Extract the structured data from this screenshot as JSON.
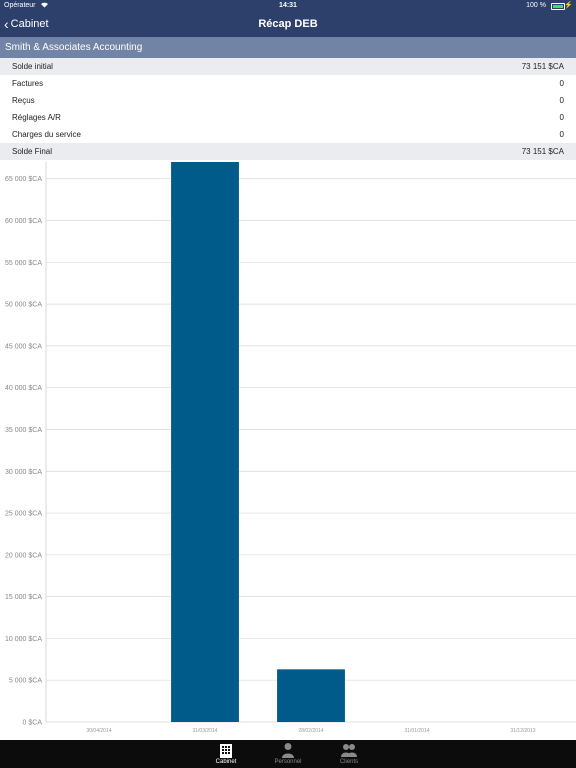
{
  "status": {
    "carrier": "Opérateur",
    "time": "14:31",
    "battery": "100 %",
    "battery_level": 1.0
  },
  "nav": {
    "back_label": "Cabinet",
    "title": "Récap DEB"
  },
  "section": {
    "title": "Smith & Associates Accounting"
  },
  "summary": [
    {
      "label": "Solde initial",
      "value": "73 151 $CA",
      "shaded": true
    },
    {
      "label": "Factures",
      "value": "0",
      "shaded": false
    },
    {
      "label": "Reçus",
      "value": "0",
      "shaded": false
    },
    {
      "label": "Réglages A/R",
      "value": "0",
      "shaded": false
    },
    {
      "label": "Charges du service",
      "value": "0",
      "shaded": false
    },
    {
      "label": "Solde Final",
      "value": "73 151 $CA",
      "shaded": true
    }
  ],
  "chart_data": {
    "type": "bar",
    "categories": [
      "30/04/2014",
      "31/03/2014",
      "28/02/2014",
      "31/01/2014",
      "31/12/2013"
    ],
    "values": [
      0,
      67000,
      6300,
      0,
      0
    ],
    "ylim": [
      0,
      67000
    ],
    "yticks": [
      0,
      5000,
      10000,
      15000,
      20000,
      25000,
      30000,
      35000,
      40000,
      45000,
      50000,
      55000,
      60000,
      65000
    ],
    "ytick_labels": [
      "0 $CA",
      "5 000 $CA",
      "10 000 $CA",
      "15 000 $CA",
      "20 000 $CA",
      "25 000 $CA",
      "30 000 $CA",
      "35 000 $CA",
      "40 000 $CA",
      "45 000 $CA",
      "50 000 $CA",
      "55 000 $CA",
      "60 000 $CA",
      "65 000 $CA"
    ],
    "grid": true,
    "bar_color": "#005a8a"
  },
  "tabs": [
    {
      "label": "Cabinet",
      "icon": "building-icon",
      "active": true
    },
    {
      "label": "Personnel",
      "icon": "person-icon",
      "active": false
    },
    {
      "label": "Clients",
      "icon": "people-icon",
      "active": false
    }
  ]
}
